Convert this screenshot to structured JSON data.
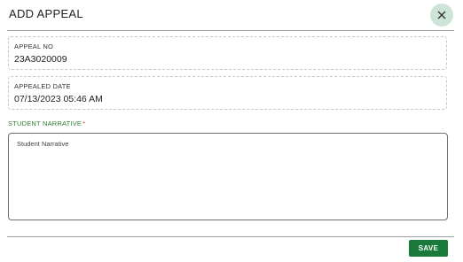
{
  "dialog": {
    "title": "ADD APPEAL",
    "close_icon": "close-icon"
  },
  "fields": {
    "appeal_no": {
      "label": "APPEAL NO",
      "value": "23A3020009"
    },
    "appealed_date": {
      "label": "APPEALED DATE",
      "value": "07/13/2023 05:46 AM"
    },
    "student_narrative": {
      "label": "STUDENT NARRATIVE",
      "required_marker": "*",
      "placeholder": "Student Narrative",
      "value": ""
    }
  },
  "actions": {
    "save_label": "SAVE"
  },
  "colors": {
    "accent": "#1b7a3a",
    "label_green": "#2e7d32",
    "required": "#e53935",
    "close_bg": "#cfe4d8"
  }
}
